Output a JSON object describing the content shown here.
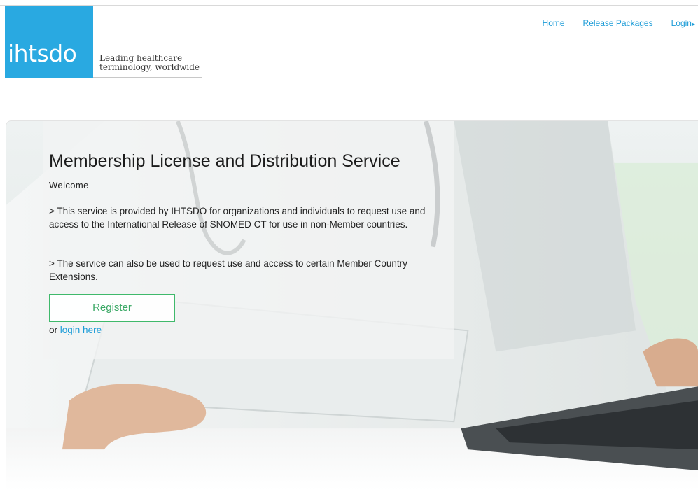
{
  "logo": {
    "wordmark": "ihtsdo",
    "tagline_line1": "Leading healthcare",
    "tagline_line2": "terminology, worldwide"
  },
  "nav": {
    "home": "Home",
    "release_packages": "Release Packages",
    "login": "Login",
    "login_caret": "▸"
  },
  "hero": {
    "title": "Membership License and Distribution Service",
    "welcome": "Welcome",
    "paragraph1": "> This service is provided by IHTSDO for organizations and individuals to request use and access to the International Release of SNOMED CT for use in non-Member countries.",
    "paragraph2": "> The service can also be used to request use and access to certain Member Country Extensions.",
    "register_label": "Register",
    "or_text": "or",
    "login_here": "login here"
  },
  "colors": {
    "brand_blue": "#29a9e1",
    "link_blue": "#1a9bd7",
    "register_green": "#3fb96b"
  }
}
